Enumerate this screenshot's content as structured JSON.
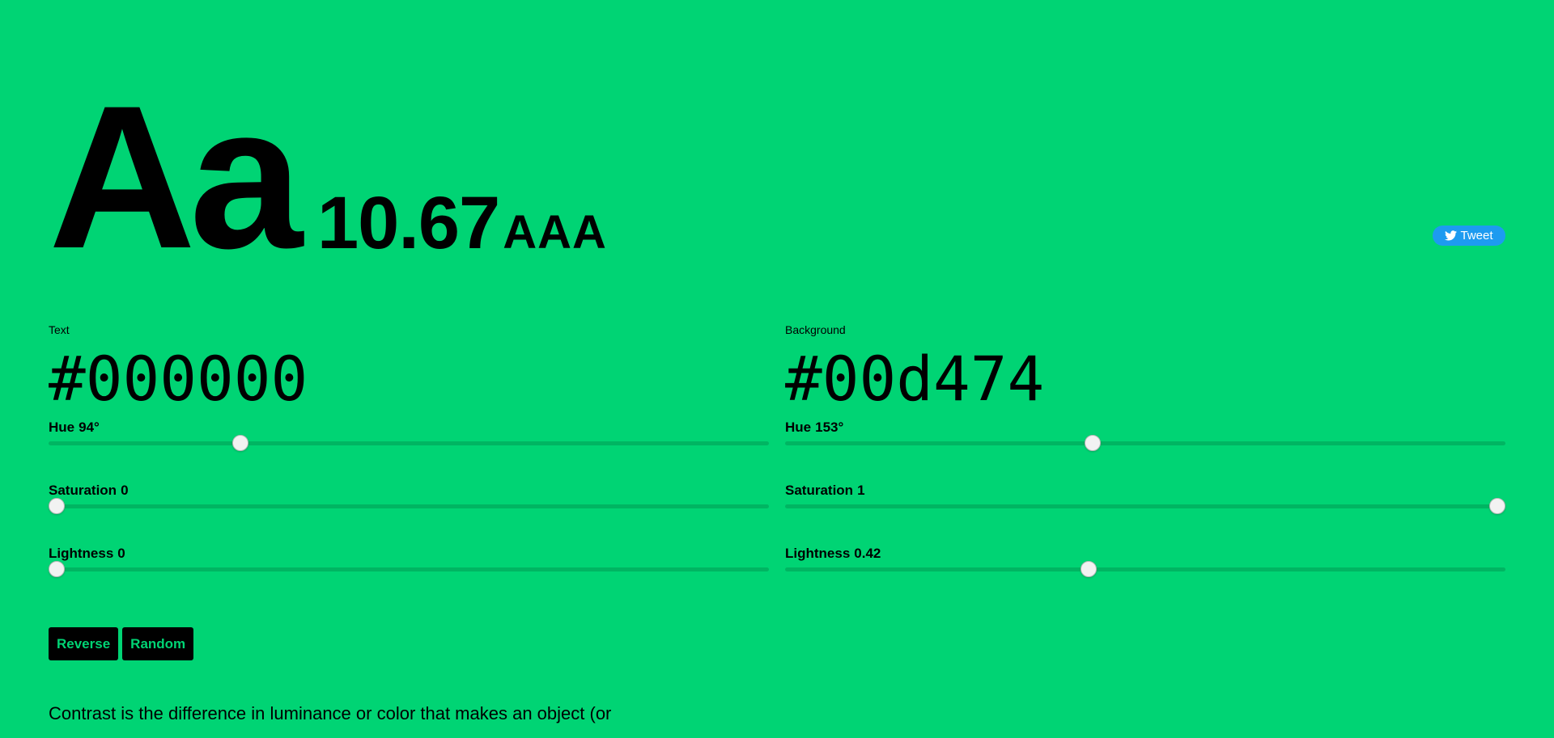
{
  "colors": {
    "text": "#000000",
    "background": "#00d474",
    "track": "#00b562",
    "tweet": "#1d9bf0",
    "button_text": "#00d474"
  },
  "hero": {
    "sample": "Aa",
    "ratio": "10.67",
    "level": "AAA"
  },
  "tweet": {
    "label": "Tweet",
    "icon": "twitter-bird-icon"
  },
  "text_color": {
    "label": "Text",
    "hex": "#000000",
    "hue": {
      "label": "Hue",
      "display": "94°",
      "value": 94,
      "max": 360
    },
    "saturation": {
      "label": "Saturation",
      "display": "0",
      "value": 0,
      "max": 1
    },
    "lightness": {
      "label": "Lightness",
      "display": "0",
      "value": 0,
      "max": 1
    }
  },
  "background_color": {
    "label": "Background",
    "hex": "#00d474",
    "hue": {
      "label": "Hue",
      "display": "153°",
      "value": 153,
      "max": 360
    },
    "saturation": {
      "label": "Saturation",
      "display": "1",
      "value": 1,
      "max": 1
    },
    "lightness": {
      "label": "Lightness",
      "display": "0.42",
      "value": 0.42,
      "max": 1
    }
  },
  "buttons": {
    "reverse": "Reverse",
    "random": "Random"
  },
  "description": "Contrast is the difference in luminance or color that makes an object (or"
}
